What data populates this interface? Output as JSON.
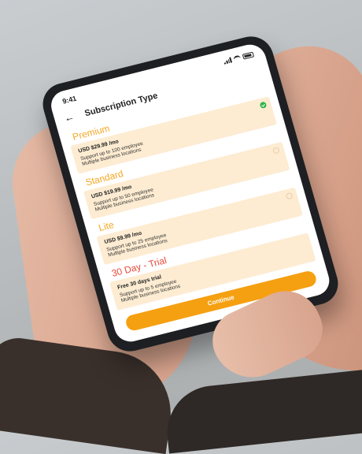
{
  "status_bar": {
    "time": "9:41"
  },
  "header": {
    "title": "Subscription Type",
    "back_icon": "back-arrow-icon"
  },
  "plans": [
    {
      "name": "Premium",
      "price": "USD $29.99 /mo",
      "line1": "Support up to 100 employee",
      "line2": "Multiple business locations",
      "selected": true
    },
    {
      "name": "Standard",
      "price": "USD $19.99 /mo",
      "line1": "Support up to 50 employee",
      "line2": "Multiple business locations",
      "selected": false
    },
    {
      "name": "Lite",
      "price": "USD $9.99 /mo",
      "line1": "Support up to 25 employee",
      "line2": "Multiple business locations",
      "selected": false
    },
    {
      "name": "30 Day - Trial",
      "price": "Free 30 days trial",
      "line1": "Support up to 5 employee",
      "line2": "Multiple business locations",
      "selected": false
    }
  ],
  "continue_label": "Continue",
  "colors": {
    "accent": "#f5a011",
    "card": "#fdecd2",
    "trial": "#e84a3a",
    "check": "#2fb34a"
  }
}
